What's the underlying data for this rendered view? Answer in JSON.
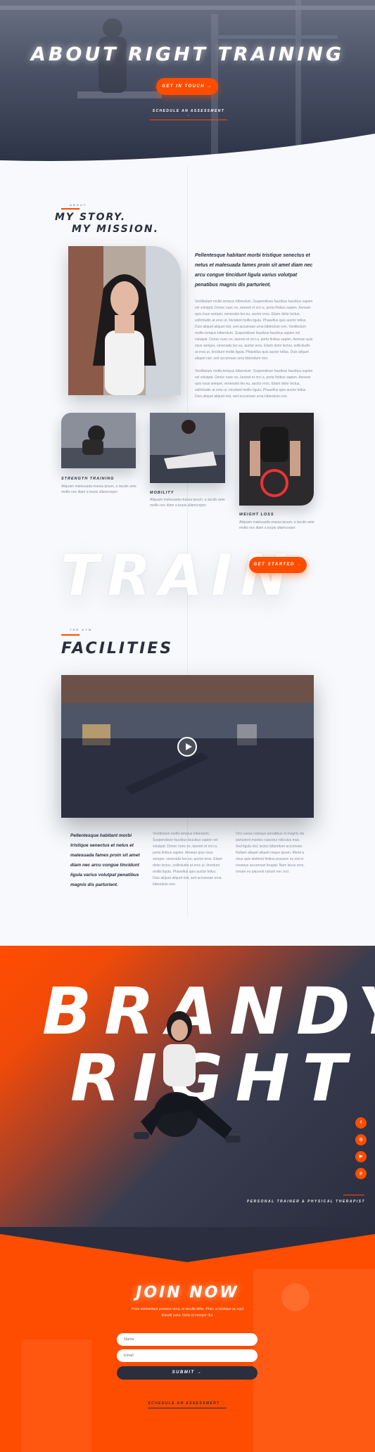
{
  "colors": {
    "accent": "#ff4d00",
    "navy": "#2a2e3f",
    "text_muted": "#8a8fa0"
  },
  "hero": {
    "title": "ABOUT RIGHT TRAINING",
    "cta_label": "GET IN TOUCH →",
    "link_label": "SCHEDULE AN ASSESSMENT →"
  },
  "story": {
    "eyebrow": "ABOUT",
    "title_line1": "MY STORY.",
    "title_line2": "MY MISSION.",
    "lead": "Pellentesque habitant morbi tristique senectus et netus et malesuada fames proin sit amet diam nec arcu congue tincidunt ligula varius volutpat penatibus magnis dis parturient.",
    "para1": "Vestibulum mollis tempus bibendum. Suspendisse faucibus faucibus sapien vel volutpat. Donec nunc ex, laoreet et orci a, porta finibus sapien. Aenean quis risus semper, venenatis leo eu, auctor eros. Etiam dolor lectus, sollicitudin at eros ut, tincidunt mollis ligula. Phasellus quis auctor tellus. Duis aliquet aliquet nisl, sed accumsan urna bibendum non. Vestibulum mollis tempus bibendum. Suspendisse faucibus faucibus sapien vel volutpat. Donec nunc ex, laoreet et orci a, porta finibus sapien. Aenean quis risus semper, venenatis leo eu, auctor eros. Etiam dolor lectus, sollicitudin at eros ut, tincidunt mollis ligula. Phasellus quis auctor tellus. Duis aliquet aliquet nisl, sed accumsan urna bibendum non.",
    "para2": "Vestibulum mollis tempus bibendum. Suspendisse faucibus faucibus sapien vel volutpat. Donec nunc ex, laoreet et orci a, porta finibus sapien. Aenean quis risus semper, venenatis leo eu, auctor eros. Etiam dolor lectus, sollicitudin at eros ut, tincidunt mollis ligula. Phasellus quis auctor tellus. Duis aliquet aliquet nisl, sed accumsan urna bibendum non."
  },
  "cards": [
    {
      "title": "STRENGTH TRAINING",
      "text": "Aliquam malesuada massa ipsum, a iaculis ante mollis nec diam a turpis ullamcorper."
    },
    {
      "title": "MOBILITY",
      "text": "Aliquam malesuada massa ipsum, a iaculis ante mollis nec diam a turpis ullamcorper."
    },
    {
      "title": "WEIGHT LOSS",
      "text": "Aliquam malesuada massa ipsum, a iaculis ante mollis nec diam a turpis ullamcorper."
    }
  ],
  "train": {
    "word": "TRAIN",
    "cta_label": "GET STARTED →"
  },
  "facilities": {
    "eyebrow": "THE GYM",
    "title": "FACILITIES",
    "lead": "Pellentesque habitant morbi tristique senectus et netus et malesuada fames proin sit amet diam nec arcu congue tincidunt ligula varius volutpat penatibus magnis dis parturient.",
    "col2": "Vestibulum mollis tempus bibendum. Suspendisse faucibus faucibus sapien vel volutpat. Donec nunc ex, laoreet et orci a, porta finibus sapien. Aenean quis risus semper, venenatis leo eu, auctor eros. Etiam dolor lectus, sollicitudin at eros ut, tincidunt mollis ligula. Phasellus quis auctor tellus. Duis aliquet aliquet nisl, sed accumsan urna bibendum non.",
    "col3": "Orci varius natoque penatibus et magnis dis parturient montes nascetur ridiculus mus. Sed ligula nisl, luctus bibendum accumsan. Nullam aliquet aliquet neque ipsum. Morbi a risus quis eleifend finibus posuere eu nisl in vivamus accumsan feugiat. Nam lacus eros, ornare eu placerat rutrum nec orci."
  },
  "brandy": {
    "line1": "BRANDY",
    "line2": "RIGHT",
    "subtitle": "PERSONAL TRAINER & PHYSICAL THERAPIST",
    "social_icons": [
      "facebook-icon",
      "instagram-icon",
      "youtube-icon",
      "pinterest-icon"
    ],
    "social_glyphs": [
      "f",
      "◎",
      "▶",
      "p"
    ]
  },
  "join": {
    "title": "JOIN NOW",
    "text": "Proin elementum posuere urna, at iaculis dolor. Proin ut tristique ac eget blandit justo. Nulla id semper dui.",
    "name_placeholder": "Name",
    "email_placeholder": "Email",
    "submit_label": "SUBMIT →",
    "link_label": "SCHEDULE AN ASSESSMENT →"
  }
}
